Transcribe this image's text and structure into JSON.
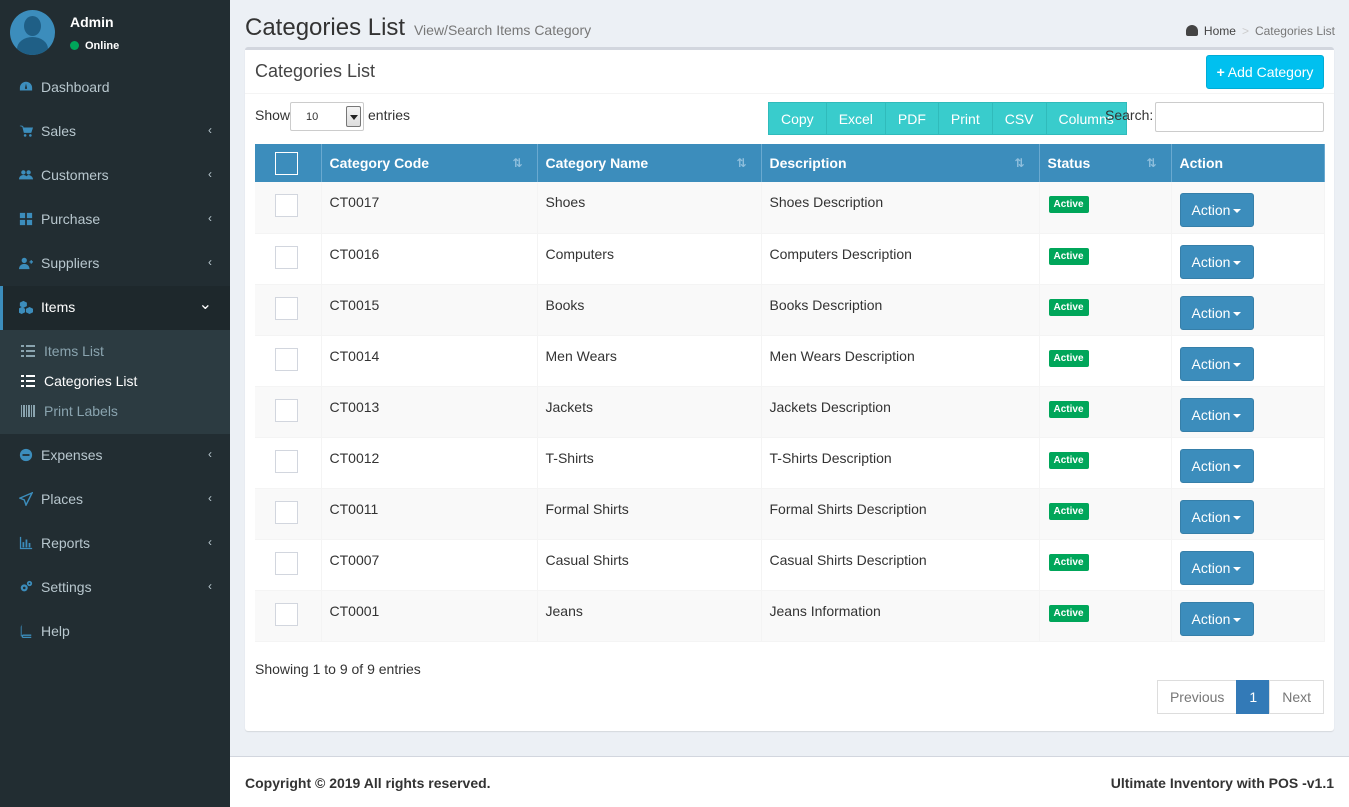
{
  "user": {
    "name": "Admin",
    "status": "Online"
  },
  "sidebar": {
    "items": [
      {
        "label": "Dashboard",
        "icon": "dashboard-icon",
        "chevron": ""
      },
      {
        "label": "Sales",
        "icon": "cart-icon",
        "chevron": "‹"
      },
      {
        "label": "Customers",
        "icon": "users-icon",
        "chevron": "‹"
      },
      {
        "label": "Purchase",
        "icon": "grid-icon",
        "chevron": "‹"
      },
      {
        "label": "Suppliers",
        "icon": "user-plus-icon",
        "chevron": "‹"
      },
      {
        "label": "Items",
        "icon": "cubes-icon",
        "chevron": "⌄"
      },
      {
        "label": "Expenses",
        "icon": "minus-circle-icon",
        "chevron": "‹"
      },
      {
        "label": "Places",
        "icon": "paper-plane-icon",
        "chevron": "‹"
      },
      {
        "label": "Reports",
        "icon": "bar-chart-icon",
        "chevron": "‹"
      },
      {
        "label": "Settings",
        "icon": "cogs-icon",
        "chevron": "‹"
      },
      {
        "label": "Help",
        "icon": "book-icon",
        "chevron": ""
      }
    ],
    "submenu": [
      {
        "label": "Items List",
        "icon": "list-icon"
      },
      {
        "label": "Categories List",
        "icon": "list-icon"
      },
      {
        "label": "Print Labels",
        "icon": "barcode-icon"
      }
    ]
  },
  "header": {
    "title": "Categories List",
    "subtitle": "View/Search Items Category",
    "breadcrumb_home": "Home",
    "breadcrumb_sep": ">",
    "breadcrumb_current": "Categories List"
  },
  "box": {
    "title": "Categories List",
    "add_button": "Add Category",
    "show_label": "Show",
    "entries_value": "10",
    "entries_label": "entries",
    "export_buttons": [
      "Copy",
      "Excel",
      "PDF",
      "Print",
      "CSV",
      "Columns"
    ],
    "search_label": "Search:",
    "search_value": ""
  },
  "table": {
    "columns": [
      "Category Code",
      "Category Name",
      "Description",
      "Status",
      "Action"
    ],
    "rows": [
      {
        "code": "CT0017",
        "name": "Shoes",
        "description": "Shoes Description",
        "status": "Active",
        "action": "Action"
      },
      {
        "code": "CT0016",
        "name": "Computers",
        "description": "Computers Description",
        "status": "Active",
        "action": "Action"
      },
      {
        "code": "CT0015",
        "name": "Books",
        "description": "Books Description",
        "status": "Active",
        "action": "Action"
      },
      {
        "code": "CT0014",
        "name": "Men Wears",
        "description": "Men Wears Description",
        "status": "Active",
        "action": "Action"
      },
      {
        "code": "CT0013",
        "name": "Jackets",
        "description": "Jackets Description",
        "status": "Active",
        "action": "Action"
      },
      {
        "code": "CT0012",
        "name": "T-Shirts",
        "description": "T-Shirts Description",
        "status": "Active",
        "action": "Action"
      },
      {
        "code": "CT0011",
        "name": "Formal Shirts",
        "description": "Formal Shirts Description",
        "status": "Active",
        "action": "Action"
      },
      {
        "code": "CT0007",
        "name": "Casual Shirts",
        "description": "Casual Shirts Description",
        "status": "Active",
        "action": "Action"
      },
      {
        "code": "CT0001",
        "name": "Jeans",
        "description": "Jeans Information",
        "status": "Active",
        "action": "Action"
      }
    ]
  },
  "pagination": {
    "info": "Showing 1 to 9 of 9 entries",
    "previous": "Previous",
    "page": "1",
    "next": "Next"
  },
  "footer": {
    "copyright": "Copyright © 2019 All rights reserved.",
    "version": "Ultimate Inventory with POS -v1.1"
  },
  "colors": {
    "sidebar_bg": "#222d32",
    "primary": "#3c8dbc",
    "info": "#00c0ef",
    "teal": "#39cccc",
    "success": "#00a65a"
  }
}
